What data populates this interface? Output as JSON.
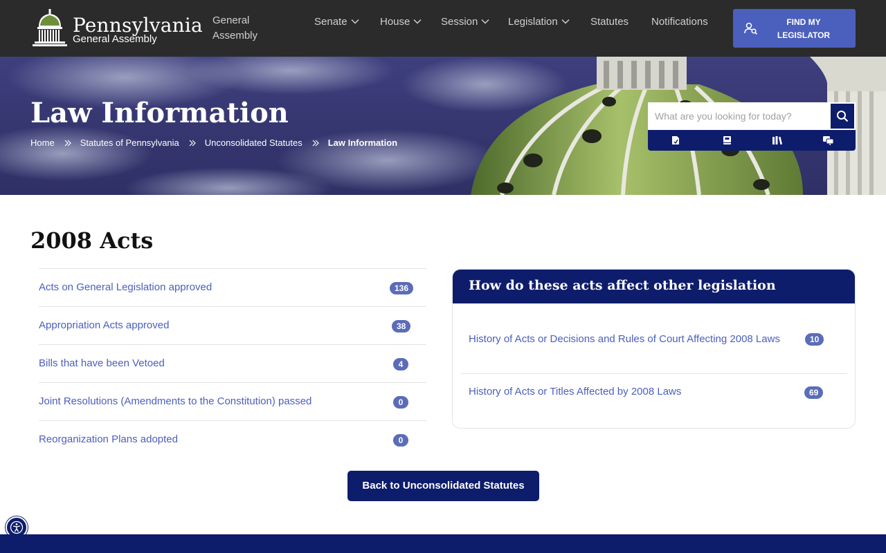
{
  "header": {
    "logo_title": "Pennsylvania",
    "logo_subtitle": "General Assembly",
    "general_assembly_link": "General Assembly",
    "nav": [
      {
        "label": "Senate",
        "has_dropdown": true
      },
      {
        "label": "House",
        "has_dropdown": true
      },
      {
        "label": "Session",
        "has_dropdown": true
      },
      {
        "label": "Legislation",
        "has_dropdown": true
      },
      {
        "label": "Statutes",
        "has_dropdown": false
      },
      {
        "label": "Notifications",
        "has_dropdown": false
      }
    ],
    "find_legislator": "FIND MY LEGISLATOR",
    "find_icon": "person-search-icon"
  },
  "hero": {
    "title": "Law Information",
    "breadcrumb": [
      "Home",
      "Statutes of Pennsylvania",
      "Unconsolidated Statutes",
      "Law Information"
    ],
    "search": {
      "placeholder": "What are you looking for today?",
      "button_icon": "search-icon",
      "tools": [
        "document-icon",
        "book-icon",
        "library-icon",
        "chat-icon"
      ]
    }
  },
  "main": {
    "heading": "2008 Acts",
    "acts": [
      {
        "label": "Acts on General Legislation approved",
        "count": "136"
      },
      {
        "label": "Appropriation Acts approved",
        "count": "38"
      },
      {
        "label": "Bills that have been Vetoed",
        "count": "4"
      },
      {
        "label": "Joint Resolutions (Amendments to the Constitution) passed",
        "count": "0"
      },
      {
        "label": "Reorganization Plans adopted",
        "count": "0"
      }
    ],
    "card": {
      "title": "How do these acts affect other legislation",
      "items": [
        {
          "label": "History of Acts or Decisions and Rules of Court Affecting 2008 Laws",
          "count": "10"
        },
        {
          "label": "History of Acts or Titles Affected by 2008 Laws",
          "count": "69"
        }
      ]
    },
    "back_button": "Back to Unconsolidated Statutes"
  },
  "accessibility_icon": "accessibility-icon",
  "colors": {
    "nav_bg": "#2b2b2b",
    "accent_blue": "#4b5fbd",
    "navy": "#0e1d6b",
    "badge": "#5b6cb8",
    "link": "#4b5fbd"
  }
}
